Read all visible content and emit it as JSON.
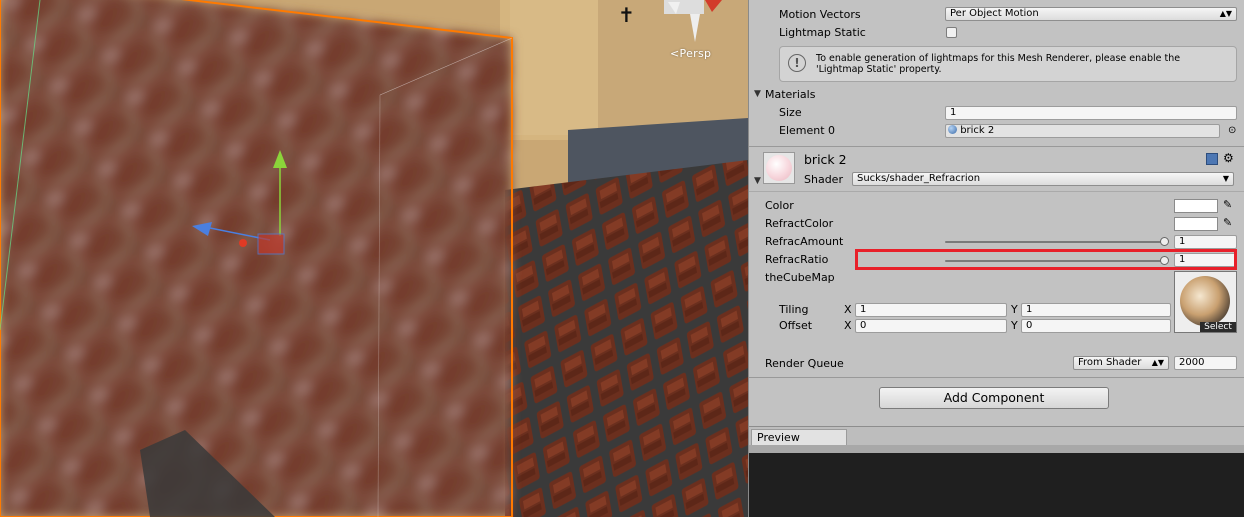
{
  "scene": {
    "view_label": "Persp",
    "icons": {
      "view_icon": "perspective-chevron-icon"
    }
  },
  "inspector": {
    "motion_vectors": {
      "label": "Motion Vectors",
      "value": "Per Object Motion"
    },
    "lightmap_static": {
      "label": "Lightmap Static",
      "checked": false
    },
    "help_text": "To enable generation of lightmaps for this Mesh Renderer, please enable the 'Lightmap Static' property.",
    "materials": {
      "header": "Materials",
      "size_label": "Size",
      "size_value": "1",
      "element0_label": "Element 0",
      "element0_value": "brick 2"
    },
    "material": {
      "name": "brick 2",
      "shader_label": "Shader",
      "shader_value": "Sucks/shader_Refracrion",
      "properties": {
        "color_label": "Color",
        "refract_color_label": "RefractColor",
        "refrac_amount_label": "RefracAmount",
        "refrac_amount_value": "1",
        "refrac_amount_fraction": 1,
        "refrac_ratio_label": "RefracRatio",
        "refrac_ratio_value": "1",
        "refrac_ratio_fraction": 1,
        "cubemap_label": "theCubeMap",
        "select_label": "Select",
        "tiling_label": "Tiling",
        "offset_label": "Offset",
        "x_label": "X",
        "y_label": "Y",
        "tiling_x": "1",
        "tiling_y": "1",
        "offset_x": "0",
        "offset_y": "0"
      },
      "render_queue_label": "Render Queue",
      "render_queue_mode": "From Shader",
      "render_queue_value": "2000"
    },
    "add_component_label": "Add Component",
    "preview_tab_label": "Preview"
  },
  "colors": {
    "highlight": "#e8202a",
    "material_swatch": "#f7d6dc",
    "selection_outline": "#ff7a00"
  }
}
